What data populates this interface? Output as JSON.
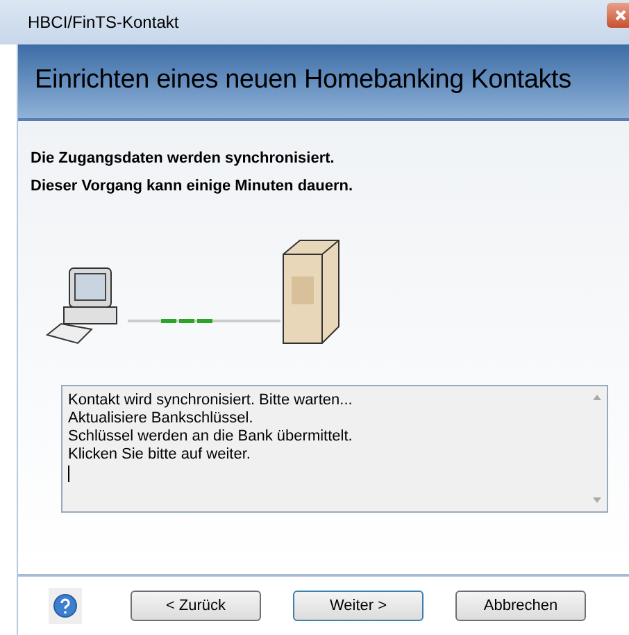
{
  "window": {
    "title": "HBCI/FinTS-Kontakt"
  },
  "header": {
    "title": "Einrichten eines neuen Homebanking Kontakts"
  },
  "intro": [
    "Die Zugangsdaten werden synchronisiert.",
    "Dieser Vorgang kann einige Minuten dauern."
  ],
  "log": {
    "lines": [
      "Kontakt wird synchronisiert. Bitte warten...",
      "Aktualisiere Bankschlüssel.",
      "Schlüssel werden an die Bank übermittelt.",
      "Klicken Sie bitte auf weiter."
    ]
  },
  "buttons": [
    {
      "label": "< Zurück",
      "default": false
    },
    {
      "label": "Weiter >",
      "default": true
    },
    {
      "label": "Abbrechen",
      "default": false
    }
  ]
}
